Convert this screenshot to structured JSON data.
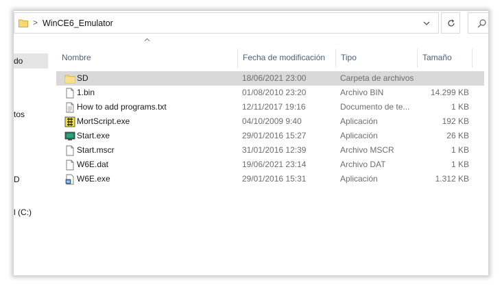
{
  "address": {
    "separator": ">",
    "path": "WinCE6_Emulator",
    "dropdown_icon": "chevron-down-icon",
    "refresh_icon": "refresh-icon",
    "search_icon": "search-icon"
  },
  "nav": {
    "items": [
      {
        "label": "do",
        "selected": true
      },
      {
        "label": "tos",
        "selected": false
      },
      {
        "label": "D",
        "selected": false
      },
      {
        "label": "l (C:)",
        "selected": false
      }
    ]
  },
  "columns": {
    "name": "Nombre",
    "date": "Fecha de modificación",
    "type": "Tipo",
    "size": "Tamaño",
    "sort_icon": "sort-up-arrow-icon"
  },
  "files": [
    {
      "name": "SD",
      "date": "18/06/2021 23:00",
      "type": "Carpeta de archivos",
      "size": "",
      "icon": "folder-icon",
      "selected": true
    },
    {
      "name": "1.bin",
      "date": "01/08/2010 23:20",
      "type": "Archivo BIN",
      "size": "14.299 KB",
      "icon": "file-icon",
      "selected": false
    },
    {
      "name": "How to add programs.txt",
      "date": "12/11/2017 19:16",
      "type": "Documento de te...",
      "size": "1 KB",
      "icon": "text-file-icon",
      "selected": false
    },
    {
      "name": "MortScript.exe",
      "date": "04/10/2009 9:40",
      "type": "Aplicación",
      "size": "192 KB",
      "icon": "script-app-icon",
      "selected": false
    },
    {
      "name": "Start.exe",
      "date": "29/01/2016 15:27",
      "type": "Aplicación",
      "size": "26 KB",
      "icon": "monitor-app-icon",
      "selected": false
    },
    {
      "name": "Start.mscr",
      "date": "31/01/2016 12:39",
      "type": "Archivo MSCR",
      "size": "1 KB",
      "icon": "file-icon",
      "selected": false
    },
    {
      "name": "W6E.dat",
      "date": "19/06/2021 23:14",
      "type": "Archivo DAT",
      "size": "1 KB",
      "icon": "file-icon",
      "selected": false
    },
    {
      "name": "W6E.exe",
      "date": "29/01/2016 15:31",
      "type": "Aplicación",
      "size": "1.312 KB",
      "icon": "exe-app-icon",
      "selected": false
    }
  ]
}
